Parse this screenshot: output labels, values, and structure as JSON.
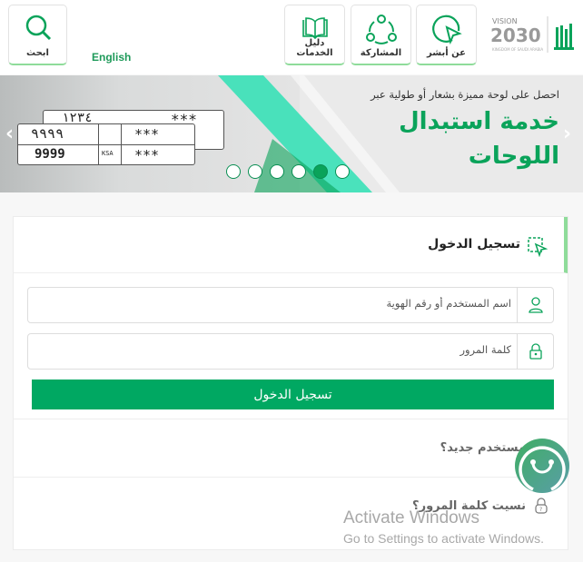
{
  "header": {
    "search_label": "ابحث",
    "language_link": "English",
    "nav": [
      {
        "label": "دليل الخدمات",
        "icon": "book-icon"
      },
      {
        "label": "المشاركة",
        "icon": "share-icon"
      },
      {
        "label": "عن أبشر",
        "icon": "cursor-icon"
      }
    ],
    "logo_text": "VISION 2030"
  },
  "banner": {
    "subtitle": "احصل على لوحة مميزة بشعار أو طولية عبر",
    "title_line1": "خدمة استبدال",
    "title_line2": "اللوحات",
    "plate_top": "١٢٣٤",
    "plate_top_stars": "***",
    "plate_ar": "٩٩٩٩",
    "plate_en": "9999",
    "plate_stars": "***",
    "plate_country": "KSA",
    "slides_count": 6,
    "active_slide": 5
  },
  "login": {
    "title": "تسجيل الدخول",
    "username_placeholder": "اسم المستخدم أو رقم الهوية",
    "password_placeholder": "كلمة المرور",
    "submit_label": "تسجيل الدخول",
    "new_user": "مستخدم جديد؟",
    "forgot_password": "نسيت كلمة المرور؟"
  },
  "watermark": {
    "line1": "Activate Windows",
    "line2": "Go to Settings to activate Windows."
  },
  "colors": {
    "accent": "#00a862",
    "border_accent": "#8fdc9a"
  }
}
